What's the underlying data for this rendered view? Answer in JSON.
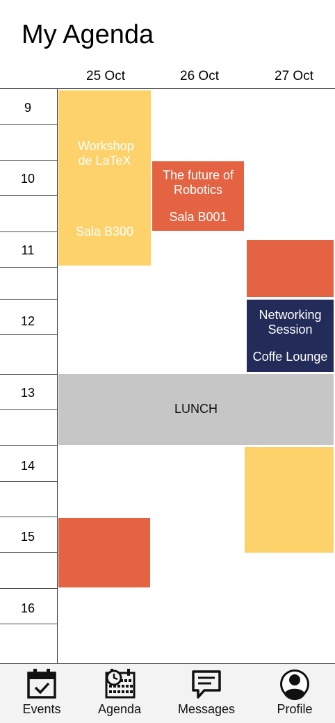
{
  "header": {
    "title": "My Agenda"
  },
  "days": [
    "25 Oct",
    "26 Oct",
    "27 Oct"
  ],
  "hours": [
    "9",
    "10",
    "11",
    "12",
    "13",
    "14",
    "15",
    "16"
  ],
  "events": {
    "workshop_latex": {
      "title": "Workshop de LaTeX",
      "room": "Sala B300"
    },
    "future_robotics": {
      "title": "The future of Robotics",
      "room": "Sala B001"
    },
    "networking": {
      "title": "Networking Session",
      "room": "Coffe Lounge"
    },
    "lunch": {
      "title": "LUNCH"
    }
  },
  "tabs": [
    {
      "label": "Events",
      "icon": "calendar-check-icon"
    },
    {
      "label": "Agenda",
      "icon": "calendar-clock-icon"
    },
    {
      "label": "Messages",
      "icon": "message-icon"
    },
    {
      "label": "Profile",
      "icon": "profile-icon"
    }
  ],
  "colors": {
    "orange": "#e36342",
    "yellow": "#fdd26b",
    "navy": "#232c58",
    "gray": "#c6c6c6"
  }
}
